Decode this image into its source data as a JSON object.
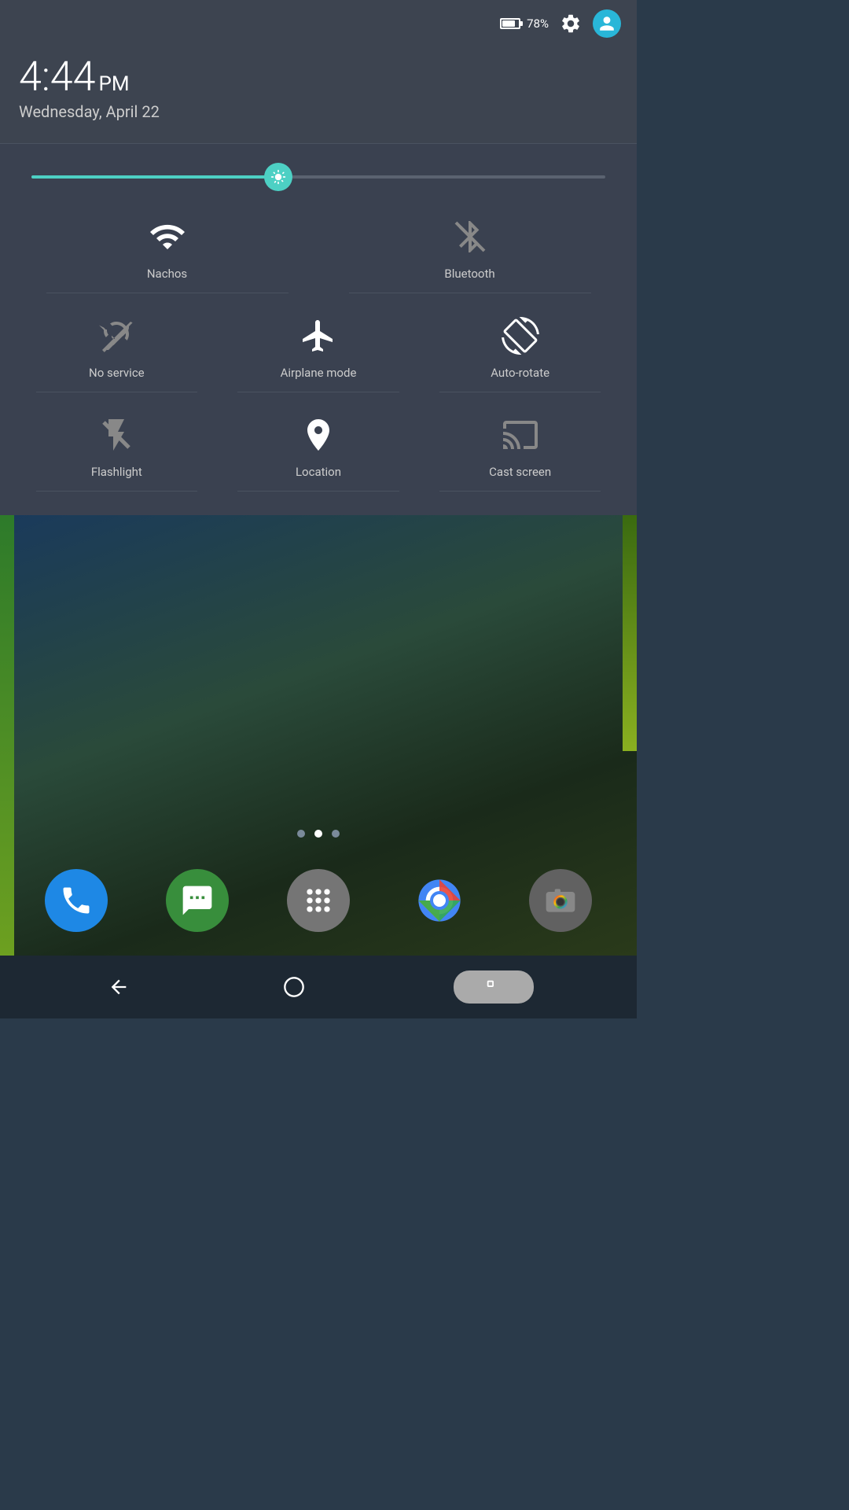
{
  "statusBar": {
    "batteryPercent": "78%",
    "settingsIconLabel": "settings",
    "accountIconLabel": "account"
  },
  "header": {
    "time": "4:44",
    "period": "PM",
    "date": "Wednesday, April 22"
  },
  "brightness": {
    "fillPercent": 43
  },
  "toggles": {
    "row1": [
      {
        "id": "wifi",
        "label": "Nachos",
        "icon": "wifi"
      },
      {
        "id": "bluetooth",
        "label": "Bluetooth",
        "icon": "bluetooth"
      }
    ],
    "row2": [
      {
        "id": "no-service",
        "label": "No service",
        "icon": "no-service"
      },
      {
        "id": "airplane",
        "label": "Airplane mode",
        "icon": "airplane"
      },
      {
        "id": "autorotate",
        "label": "Auto-rotate",
        "icon": "autorotate"
      }
    ],
    "row3": [
      {
        "id": "flashlight",
        "label": "Flashlight",
        "icon": "flashlight"
      },
      {
        "id": "location",
        "label": "Location",
        "icon": "location"
      },
      {
        "id": "cast",
        "label": "Cast screen",
        "icon": "cast"
      }
    ]
  },
  "dock": {
    "apps": [
      {
        "id": "phone",
        "label": "Phone"
      },
      {
        "id": "hangouts",
        "label": "Hangouts"
      },
      {
        "id": "launcher",
        "label": "Launcher"
      },
      {
        "id": "chrome",
        "label": "Chrome"
      },
      {
        "id": "camera",
        "label": "Camera"
      }
    ]
  },
  "nav": {
    "backLabel": "Back",
    "homeLabel": "Home",
    "recentsLabel": "Recents"
  }
}
